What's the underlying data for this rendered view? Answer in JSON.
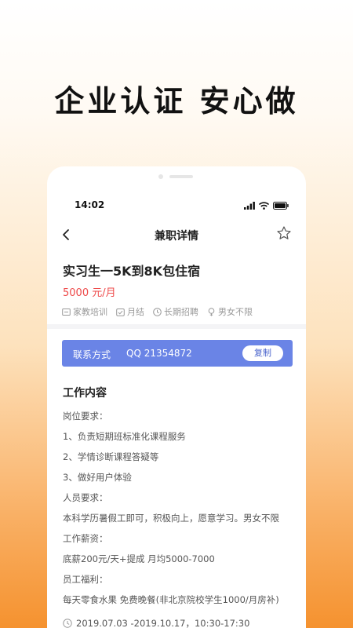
{
  "headline": "企业认证 安心做",
  "status_bar": {
    "time": "14:02"
  },
  "navbar": {
    "title": "兼职详情"
  },
  "job": {
    "title": "实习生一5K到8K包住宿",
    "salary": "5000 元/月",
    "tags": [
      {
        "label": "家教培训",
        "icon": "category-icon"
      },
      {
        "label": "月结",
        "icon": "check-calendar-icon"
      },
      {
        "label": "长期招聘",
        "icon": "clock-icon"
      },
      {
        "label": "男女不限",
        "icon": "gender-icon"
      }
    ]
  },
  "contact": {
    "label": "联系方式",
    "value": "QQ 21354872",
    "copy_label": "复制"
  },
  "work": {
    "section_title": "工作内容",
    "lines": [
      "岗位要求：",
      "1、负责短期班标准化课程服务",
      "2、学情诊断课程答疑等",
      "3、做好用户体验",
      "人员要求：",
      "本科学历暑假工即可，积极向上，愿意学习。男女不限",
      "工作薪资：",
      "底薪200元/天+提成 月均5000-7000",
      "员工福利：",
      "每天零食水果 免费晚餐(非北京院校学生1000/月房补)"
    ],
    "schedule": "2019.07.03 -2019.10.17，10:30-17:30"
  },
  "colors": {
    "accent": "#6a84e6",
    "salary": "#ee4a4a",
    "background_bottom": "#f5922f"
  }
}
